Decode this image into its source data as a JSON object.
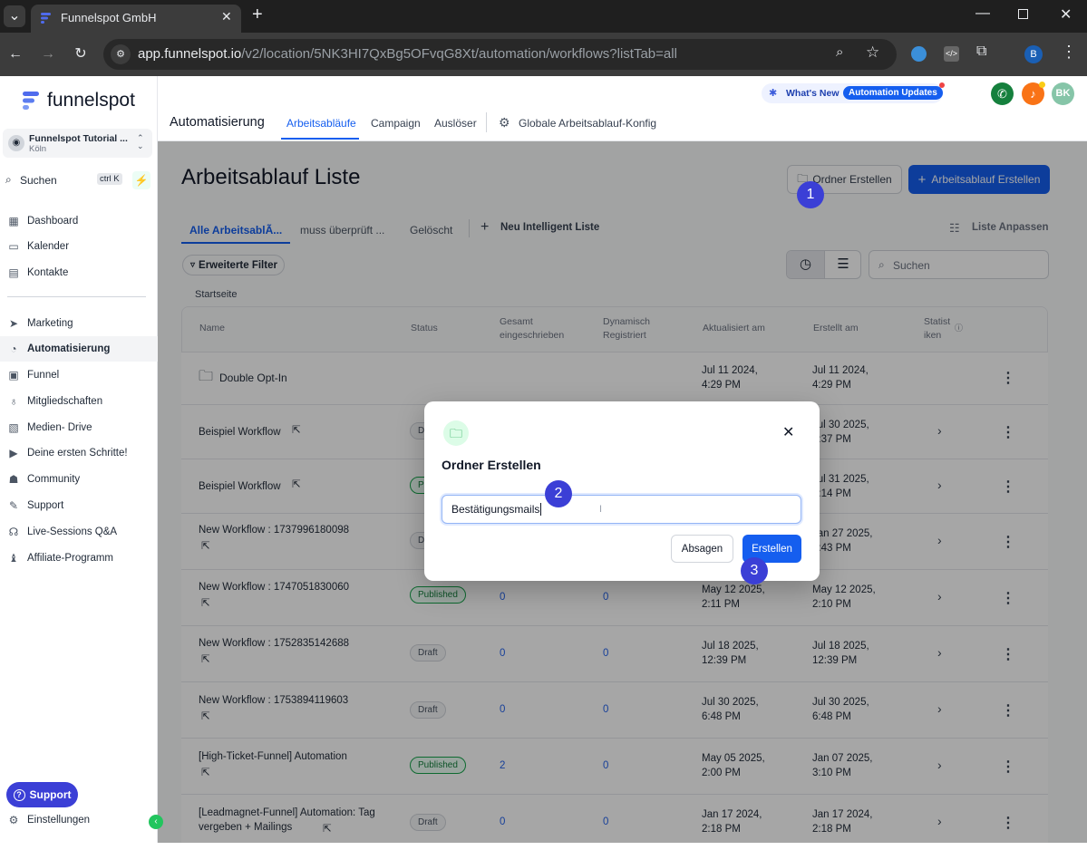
{
  "browser": {
    "tab_title": "Funnelspot GmbH",
    "url_host": "app.funnelspot.io",
    "url_path": "/v2/location/5NK3HI7QxBg5OFvqG8Xt/automation/workflows?listTab=all",
    "profile_initial": "B"
  },
  "sidebar": {
    "brand": "funnelspot",
    "account_name": "Funnelspot Tutorial ...",
    "account_location": "Köln",
    "search_label": "Suchen",
    "search_shortcut": "ctrl K",
    "items": [
      {
        "label": "Dashboard",
        "icon": "grid-icon"
      },
      {
        "label": "Kalender",
        "icon": "calendar-icon"
      },
      {
        "label": "Kontakte",
        "icon": "contacts-icon"
      },
      {
        "label": "Marketing",
        "icon": "send-icon"
      },
      {
        "label": "Automatisierung",
        "icon": "automation-icon"
      },
      {
        "label": "Funnel",
        "icon": "funnel-icon"
      },
      {
        "label": "Mitgliedschaften",
        "icon": "badge-icon"
      },
      {
        "label": "Medien- Drive",
        "icon": "image-icon"
      },
      {
        "label": "Deine ersten Schritte!",
        "icon": "play-icon"
      },
      {
        "label": "Community",
        "icon": "community-icon"
      },
      {
        "label": "Support",
        "icon": "wrench-icon"
      },
      {
        "label": "Live-Sessions Q&A",
        "icon": "live-icon"
      },
      {
        "label": "Affiliate-Programm",
        "icon": "affiliate-icon"
      }
    ],
    "support_button": "Support",
    "settings_label": "Einstellungen"
  },
  "header": {
    "whats_new": "What's New",
    "automation_updates": "Automation Updates",
    "avatar_initials": "BK",
    "section_title": "Automatisierung",
    "tabs": [
      "Arbeitsabläufe",
      "Campaign",
      "Auslöser",
      "Globale Arbeitsablauf-Konfig"
    ]
  },
  "page": {
    "title": "Arbeitsablauf Liste",
    "create_folder": "Ordner Erstellen",
    "create_workflow": "Arbeitsablauf Erstellen",
    "list_tabs": [
      "Alle ArbeitsablÃ...",
      "muss überprüft ...",
      "Gelöscht"
    ],
    "new_smart_list": "Neu Intelligent Liste",
    "customize_list": "Liste Anpassen",
    "advanced_filter": "Erweiterte Filter",
    "search_placeholder": "Suchen",
    "breadcrumb": "Startseite"
  },
  "table": {
    "headers": {
      "name": "Name",
      "status": "Status",
      "enrolled": "Gesamt eingeschrieben",
      "dynamic": "Dynamisch Registriert",
      "updated": "Aktualisiert am",
      "created": "Erstellt am",
      "stats": "Statist iken"
    },
    "rows": [
      {
        "name": "Double Opt-In",
        "status": "",
        "enrolled": "",
        "dynamic": "",
        "updated": "Jul 11 2024, 4:29 PM",
        "created": "Jul 11 2024, 4:29 PM"
      },
      {
        "name": "Beispiel Workflow",
        "status": "Draft",
        "enrolled": "",
        "dynamic": "",
        "updated": "",
        "created": "Jul 30 2025, 3:37 PM"
      },
      {
        "name": "Beispiel Workflow",
        "status": "Published",
        "enrolled": "",
        "dynamic": "",
        "updated": "",
        "created": "Jul 31 2025, 3:14 PM"
      },
      {
        "name": "New Workflow : 1737996180098",
        "status": "Draft",
        "enrolled": "",
        "dynamic": "",
        "updated": "",
        "created": "Jan 27 2025, 3:43 PM"
      },
      {
        "name": "New Workflow : 1747051830060",
        "status": "Published",
        "enrolled": "0",
        "dynamic": "0",
        "updated": "May 12 2025, 2:11 PM",
        "created": "May 12 2025, 2:10 PM"
      },
      {
        "name": "New Workflow : 1752835142688",
        "status": "Draft",
        "enrolled": "0",
        "dynamic": "0",
        "updated": "Jul 18 2025, 12:39 PM",
        "created": "Jul 18 2025, 12:39 PM"
      },
      {
        "name": "New Workflow : 1753894119603",
        "status": "Draft",
        "enrolled": "0",
        "dynamic": "0",
        "updated": "Jul 30 2025, 6:48 PM",
        "created": "Jul 30 2025, 6:48 PM"
      },
      {
        "name": "[High-Ticket-Funnel] Automation",
        "status": "Published",
        "enrolled": "2",
        "dynamic": "0",
        "updated": "May 05 2025, 2:00 PM",
        "created": "Jan 07 2025, 3:10 PM"
      },
      {
        "name": "[Leadmagnet-Funnel] Automation: Tag vergeben + Mailings",
        "status": "Draft",
        "enrolled": "0",
        "dynamic": "0",
        "updated": "Jan 17 2024, 2:18 PM",
        "created": "Jan 17 2024, 2:18 PM"
      }
    ]
  },
  "modal": {
    "title": "Ordner Erstellen",
    "input_value": "Bestätigungsmails",
    "cancel": "Absagen",
    "submit": "Erstellen"
  },
  "steps": [
    "1",
    "2",
    "3"
  ],
  "colors": {
    "primary": "#155eef",
    "step": "#3b3fd6",
    "published": "#16a34a"
  }
}
